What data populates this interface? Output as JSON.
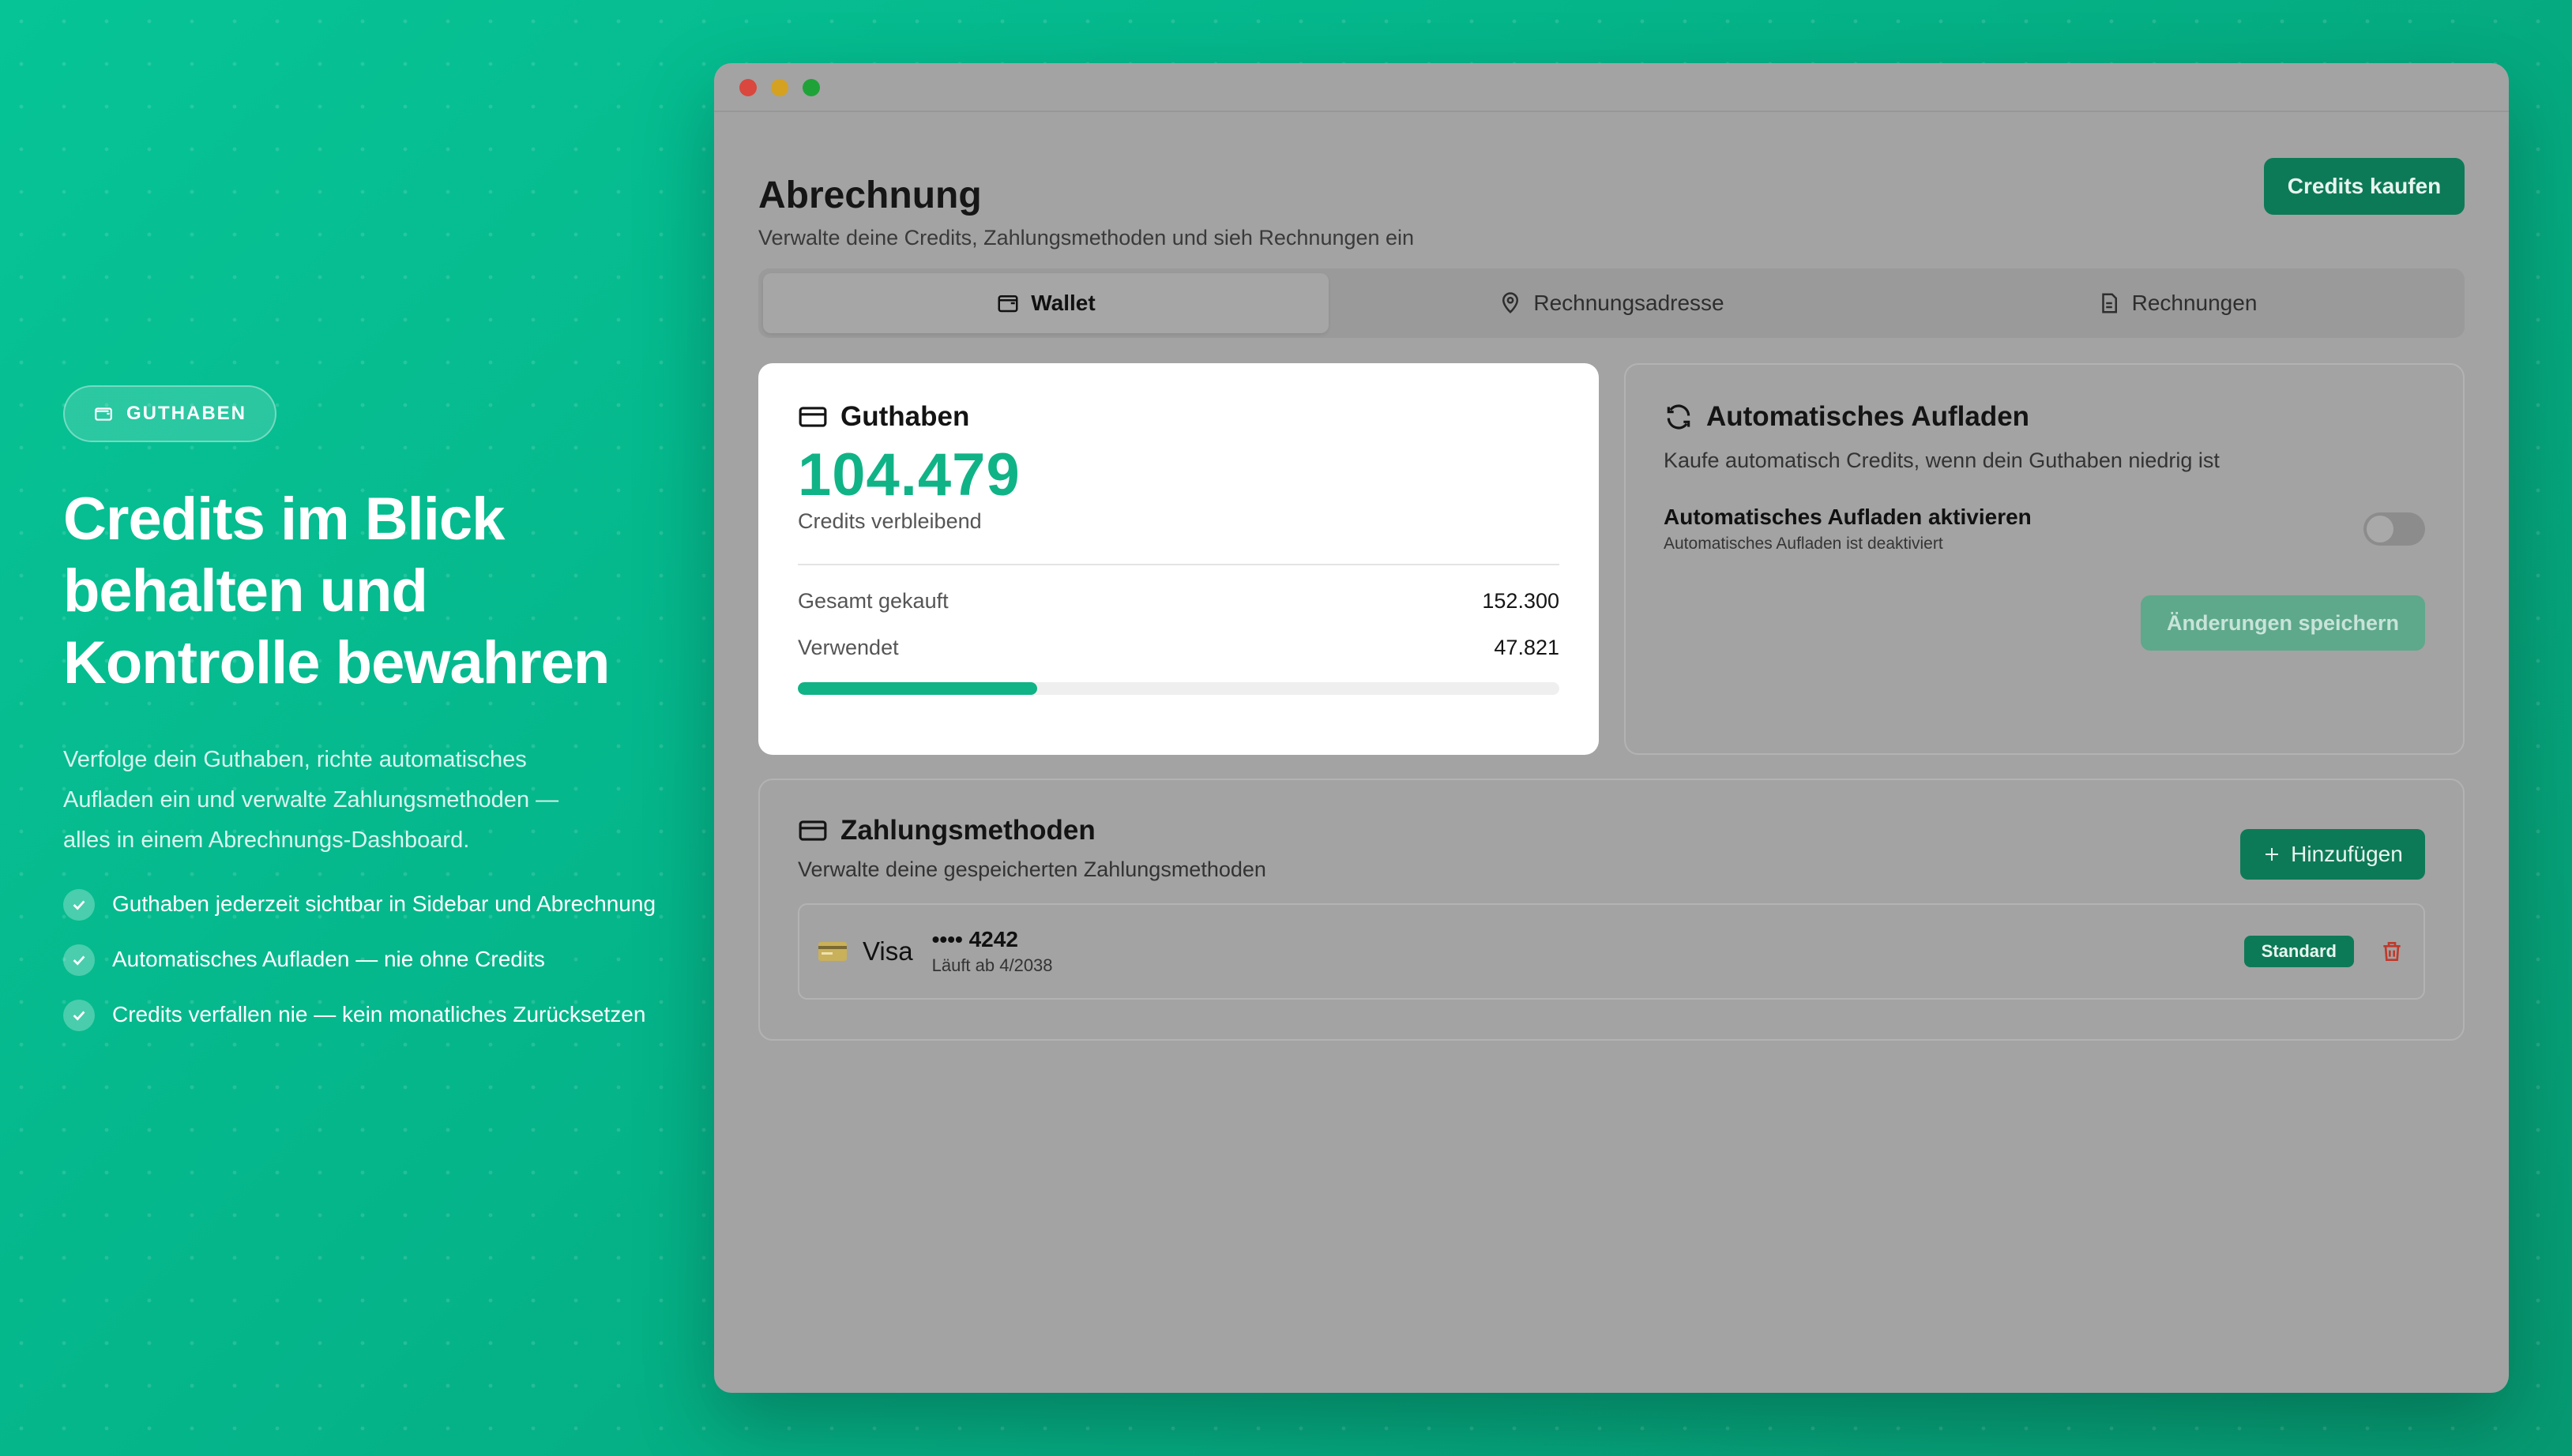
{
  "hero": {
    "badge": "GUTHABEN",
    "title_line1": "Credits im Blick",
    "title_line2": "behalten und",
    "title_line3": "Kontrolle bewahren",
    "lead": "Verfolge dein Guthaben, richte automatisches Aufladen ein und verwalte Zahlungsmethoden — alles in einem Abrechnungs-Dashboard.",
    "features": [
      "Guthaben jederzeit sichtbar in Sidebar und Abrechnung",
      "Automatisches Aufladen — nie ohne Credits",
      "Credits verfallen nie — kein monatliches Zurücksetzen"
    ]
  },
  "app": {
    "title": "Abrechnung",
    "subtitle": "Verwalte deine Credits, Zahlungsmethoden und sieh Rechnungen ein",
    "buy_button": "Credits kaufen",
    "tabs": [
      {
        "label": "Wallet",
        "icon": "wallet-icon",
        "active": true
      },
      {
        "label": "Rechnungsadresse",
        "icon": "map-pin-icon",
        "active": false
      },
      {
        "label": "Rechnungen",
        "icon": "document-icon",
        "active": false
      }
    ]
  },
  "balance": {
    "title": "Guthaben",
    "amount": "104.479",
    "amount_label": "Credits verbleibend",
    "purchased_label": "Gesamt gekauft",
    "purchased_value": "152.300",
    "used_label": "Verwendet",
    "used_value": "47.821",
    "used_fraction": 0.314
  },
  "auto_topup": {
    "title": "Automatisches Aufladen",
    "description": "Kaufe automatisch Credits, wenn dein Guthaben niedrig ist",
    "toggle_label": "Automatisches Aufladen aktivieren",
    "toggle_status": "Automatisches Aufladen ist deaktiviert",
    "enabled": false,
    "save_button": "Änderungen speichern"
  },
  "payment": {
    "title": "Zahlungsmethoden",
    "subtitle": "Verwalte deine gespeicherten Zahlungsmethoden",
    "add_button": "Hinzufügen",
    "methods": [
      {
        "brand": "Visa",
        "number": "•••• 4242",
        "expiry": "Läuft ab 4/2038",
        "badge": "Standard"
      }
    ]
  },
  "colors": {
    "accent": "#10b386",
    "button": "#0d7a57",
    "danger": "#c0392b"
  }
}
